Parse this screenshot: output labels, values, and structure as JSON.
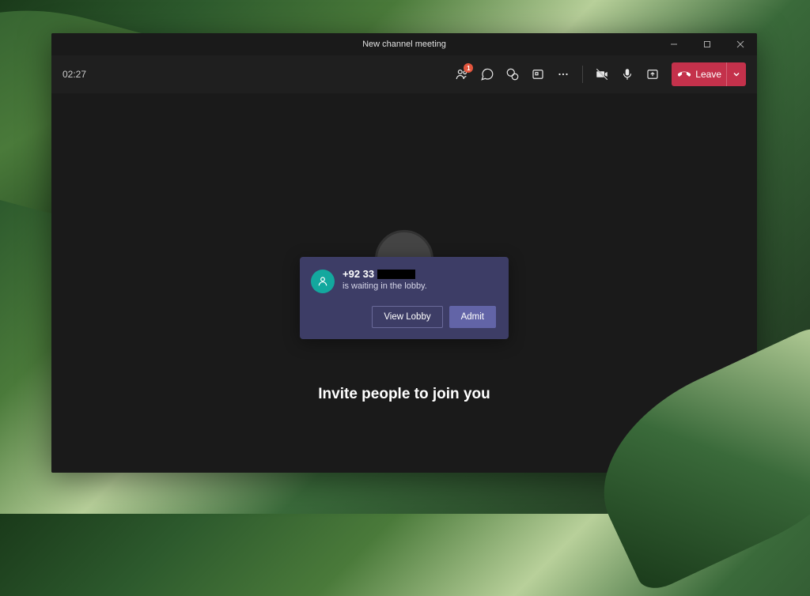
{
  "window": {
    "title": "New channel meeting"
  },
  "toolbar": {
    "timer": "02:27",
    "people_badge": "1",
    "leave_label": "Leave"
  },
  "main": {
    "invite_text": "Invite people to join you"
  },
  "lobby_popup": {
    "caller_prefix": "+92 33",
    "subtitle": "is waiting in the lobby.",
    "view_lobby_label": "View Lobby",
    "admit_label": "Admit"
  }
}
